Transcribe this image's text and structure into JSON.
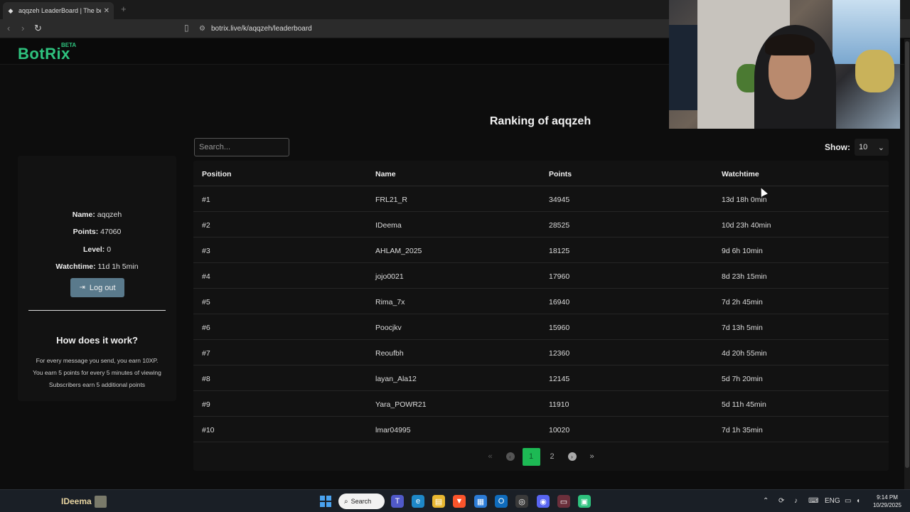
{
  "browser": {
    "tab_title": "aqqzeh LeaderBoard | The best C",
    "tab_close": "✕",
    "new_tab": "+",
    "url": "botrix.live/k/aqqzeh/leaderboard"
  },
  "site": {
    "logo": "BotRix",
    "logo_badge": "BETA",
    "accent": "#2ec27e"
  },
  "ranking": {
    "title": "Ranking of aqqzeh",
    "search_placeholder": "Search...",
    "show_label": "Show:",
    "show_value": "10"
  },
  "profile": {
    "name_label": "Name:",
    "name_value": "aqqzeh",
    "points_label": "Points:",
    "points_value": "47060",
    "level_label": "Level:",
    "level_value": "0",
    "watchtime_label": "Watchtime:",
    "watchtime_value": "11d 1h 5min",
    "logout_label": "Log out",
    "how_title": "How does it work?",
    "how_lines": [
      "For every message you send, you earn 10XP.",
      "You earn 5 points for every 5 minutes of viewing",
      "Subscribers earn 5 additional points"
    ]
  },
  "table": {
    "headers": [
      "Position",
      "Name",
      "Points",
      "Watchtime"
    ],
    "rows": [
      [
        "#1",
        "FRL21_R",
        "34945",
        "13d 18h 0min"
      ],
      [
        "#2",
        "IDeema",
        "28525",
        "10d 23h 40min"
      ],
      [
        "#3",
        "AHLAM_2025",
        "18125",
        "9d 6h 10min"
      ],
      [
        "#4",
        "jojo0021",
        "17960",
        "8d 23h 15min"
      ],
      [
        "#5",
        "Rima_7x",
        "16940",
        "7d 2h 45min"
      ],
      [
        "#6",
        "Poocjkv",
        "15960",
        "7d 13h 5min"
      ],
      [
        "#7",
        "Reoufbh",
        "12360",
        "4d 20h 55min"
      ],
      [
        "#8",
        "layan_Ala12",
        "12145",
        "5d 7h 20min"
      ],
      [
        "#9",
        "Yara_POWR21",
        "11910",
        "5d 11h 45min"
      ],
      [
        "#10",
        "lmar04995",
        "10020",
        "7d 1h 35min"
      ]
    ]
  },
  "pagination": {
    "first": "«",
    "prev": "‹",
    "pages": [
      "1",
      "2"
    ],
    "current": "1",
    "next": "›",
    "last": "»"
  },
  "taskbar": {
    "user": "IDeema",
    "search_label": "Search",
    "language": "ENG",
    "time": "9:14 PM",
    "date": "10/29/2025"
  }
}
